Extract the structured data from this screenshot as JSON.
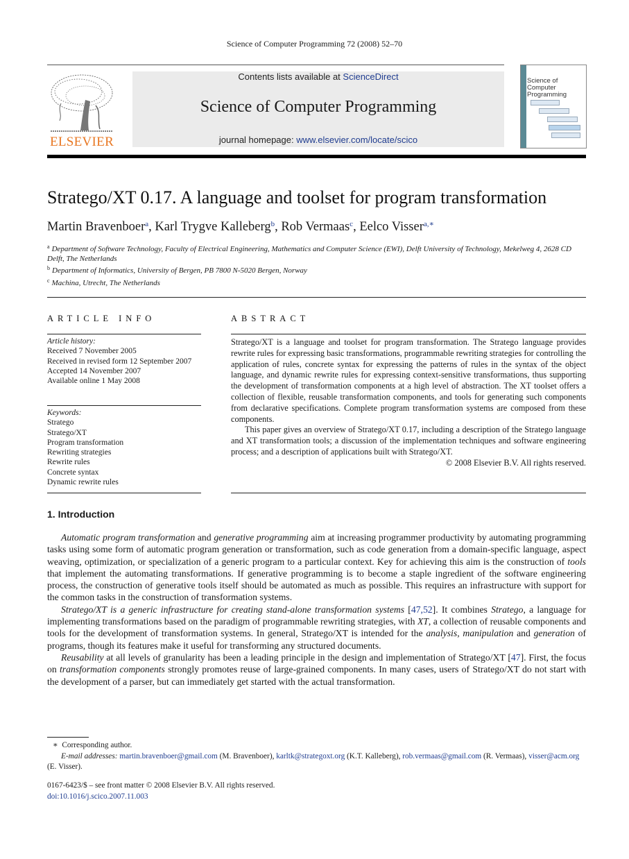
{
  "running_head": "Science of Computer Programming 72 (2008) 52–70",
  "masthead": {
    "publisher_logo_text": "ELSEVIER",
    "contents_prefix": "Contents lists available at ",
    "contents_link": "ScienceDirect",
    "journal_name": "Science of Computer Programming",
    "homepage_prefix": "journal homepage: ",
    "homepage_link": "www.elsevier.com/locate/scico",
    "cover_title_line1": "Science of Computer",
    "cover_title_line2": "Programming",
    "brand_orange": "#e87722",
    "link_blue": "#1f3c8f"
  },
  "article": {
    "title": "Stratego/XT 0.17. A language and toolset for program transformation",
    "authors": [
      {
        "name": "Martin Bravenboer",
        "marks": "a"
      },
      {
        "name": "Karl Trygve Kalleberg",
        "marks": "b"
      },
      {
        "name": "Rob Vermaas",
        "marks": "c"
      },
      {
        "name": "Eelco Visser",
        "marks": "a,∗"
      }
    ],
    "affiliations": [
      {
        "mark": "a",
        "text": "Department of Software Technology, Faculty of Electrical Engineering, Mathematics and Computer Science (EWI), Delft University of Technology, Mekelweg 4, 2628 CD Delft, The Netherlands"
      },
      {
        "mark": "b",
        "text": "Department of Informatics, University of Bergen, PB 7800 N-5020 Bergen, Norway"
      },
      {
        "mark": "c",
        "text": "Machina, Utrecht, The Netherlands"
      }
    ]
  },
  "article_info": {
    "heading": "ARTICLE INFO",
    "history_label": "Article history:",
    "history": [
      "Received 7 November 2005",
      "Received in revised form 12 September 2007",
      "Accepted 14 November 2007",
      "Available online 1 May 2008"
    ],
    "keywords_label": "Keywords:",
    "keywords": [
      "Stratego",
      "Stratego/XT",
      "Program transformation",
      "Rewriting strategies",
      "Rewrite rules",
      "Concrete syntax",
      "Dynamic rewrite rules"
    ]
  },
  "abstract": {
    "heading": "ABSTRACT",
    "paragraph1": "Stratego/XT is a language and toolset for program transformation. The Stratego language provides rewrite rules for expressing basic transformations, programmable rewriting strategies for controlling the application of rules, concrete syntax for expressing the patterns of rules in the syntax of the object language, and dynamic rewrite rules for expressing context-sensitive transformations, thus supporting the development of transformation components at a high level of abstraction. The XT toolset offers a collection of flexible, reusable transformation components, and tools for generating such components from declarative specifications. Complete program transformation systems are composed from these components.",
    "paragraph2": "This paper gives an overview of Stratego/XT 0.17, including a description of the Stratego language and XT transformation tools; a discussion of the implementation techniques and software engineering process; and a description of applications built with Stratego/XT.",
    "copyright": "© 2008 Elsevier B.V. All rights reserved."
  },
  "introduction": {
    "heading": "1.  Introduction",
    "p1": {
      "em1": "Automatic program transformation",
      "t1": " and ",
      "em2": "generative programming",
      "t2": " aim at increasing programmer productivity by automating programming tasks using some form of automatic program generation or transformation, such as code generation from a domain-specific language, aspect weaving, optimization, or specialization of a generic program to a particular context. Key for achieving this aim is the construction of ",
      "em3": "tools",
      "t3": " that implement the automating transformations. If generative programming is to become a staple ingredient of the software engineering process, the construction of generative tools itself should be automated as much as possible. This requires an infrastructure with support for the common tasks in the construction of transformation systems."
    },
    "p2": {
      "em1": "Stratego/XT is a generic infrastructure for creating stand-alone transformation systems",
      "t1": " [",
      "ref1": "47,52",
      "t2": "]. It combines ",
      "em2": "Stratego",
      "t3": ", a language for implementing transformations based on the paradigm of programmable rewriting strategies, with ",
      "em3": "XT",
      "t4": ", a collection of reusable components and tools for the development of transformation systems. In general, Stratego/XT is intended for the ",
      "em4": "analysis",
      "t5": ", ",
      "em5": "manipulation",
      "t6": " and ",
      "em6": "generation",
      "t7": " of programs, though its features make it useful for transforming any structured documents."
    },
    "p3": {
      "em1": "Reusability",
      "t1": " at all levels of granularity has been a leading principle in the design and implementation of Stratego/XT [",
      "ref1": "47",
      "t2": "]. First, the focus on ",
      "em2": "transformation components",
      "t3": " strongly promotes reuse of large-grained components. In many cases, users of Stratego/XT do not start with the development of a parser, but can immediately get started with the actual transformation."
    }
  },
  "footnotes": {
    "corresponding_mark": "∗",
    "corresponding_text": "Corresponding author.",
    "email_label": "E-mail addresses:",
    "emails": [
      {
        "address": "martin.bravenboer@gmail.com",
        "who": " (M. Bravenboer), "
      },
      {
        "address": "karltk@strategoxt.org",
        "who": " (K.T. Kalleberg), "
      },
      {
        "address": "rob.vermaas@gmail.com",
        "who": " (R. Vermaas), "
      },
      {
        "address": "visser@acm.org",
        "who": " (E. Visser)."
      }
    ]
  },
  "front_matter": {
    "issn_line": "0167-6423/$ – see front matter © 2008 Elsevier B.V. All rights reserved.",
    "doi": "doi:10.1016/j.scico.2007.11.003"
  }
}
